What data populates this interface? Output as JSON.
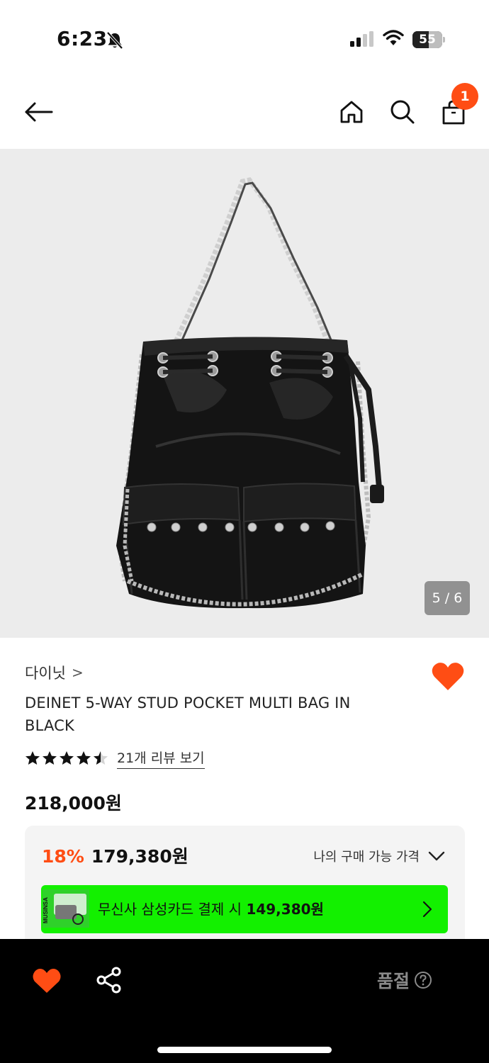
{
  "status_bar": {
    "time": "6:23",
    "battery": "55",
    "battery_level": 0.55,
    "icons": [
      "bell-off-icon",
      "signal-icon",
      "wifi-icon",
      "battery-icon"
    ]
  },
  "header": {
    "cart_count": "1",
    "icons": [
      "back-arrow-icon",
      "home-icon",
      "search-icon",
      "shopping-bag-icon"
    ]
  },
  "gallery": {
    "page_indicator": "5 / 6"
  },
  "product": {
    "brand": "다이닛",
    "brand_chevron": ">",
    "name": "DEINET 5-WAY STUD POCKET MULTI BAG IN BLACK",
    "rating": 4.5,
    "review_link": "21개 리뷰 보기",
    "original_price": "218,000원"
  },
  "benefit": {
    "discount_rate": "18%",
    "discount_price": "179,380원",
    "toggle_label": "나의 구매 가능 가격",
    "card_text_prefix": "무신사 삼성카드 결제 시 ",
    "card_price": "149,380원",
    "card_thumb_text": "MUSINSA"
  },
  "bottom_bar": {
    "status_label": "품절"
  },
  "colors": {
    "accent": "#ff4d14",
    "card_green": "#13f000",
    "image_bg": "#ececec"
  }
}
